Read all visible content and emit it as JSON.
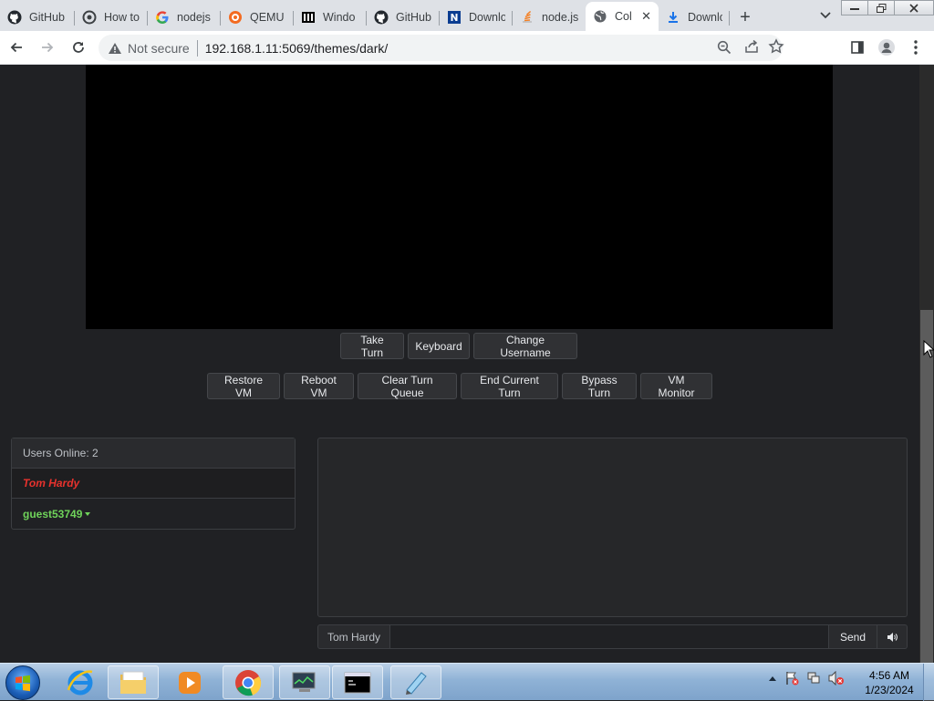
{
  "browser": {
    "tabs": [
      {
        "label": "GitHub",
        "icon": "github-icon"
      },
      {
        "label": "How to",
        "icon": "tool-icon"
      },
      {
        "label": "nodejs",
        "icon": "google-icon"
      },
      {
        "label": "QEMU",
        "icon": "qemu-icon"
      },
      {
        "label": "Windo",
        "icon": "archive-icon"
      },
      {
        "label": "GitHub",
        "icon": "github-icon"
      },
      {
        "label": "Downlo",
        "icon": "n-icon"
      },
      {
        "label": "node.js",
        "icon": "stack-icon"
      },
      {
        "label": "Col",
        "icon": "globe-icon",
        "active": true
      },
      {
        "label": "Downlo",
        "icon": "download-icon"
      }
    ],
    "new_tab": "+",
    "security_label": "Not secure",
    "url": "192.168.1.11:5069/themes/dark/"
  },
  "vm": {
    "turn_buttons": {
      "take_turn": "Take Turn",
      "keyboard": "Keyboard",
      "change_username": "Change Username"
    },
    "admin_buttons": {
      "restore_vm": "Restore VM",
      "reboot_vm": "Reboot VM",
      "clear_turn_queue": "Clear Turn Queue",
      "end_current_turn": "End Current Turn",
      "bypass_turn": "Bypass Turn",
      "vm_monitor": "VM Monitor"
    }
  },
  "users": {
    "header": "Users Online: 2",
    "list": [
      {
        "name": "Tom Hardy",
        "has_turn": true
      },
      {
        "name": "guest53749",
        "self": true
      }
    ]
  },
  "chat": {
    "username": "Tom Hardy",
    "message": "",
    "send_label": "Send"
  },
  "taskbar": {
    "time": "4:56 AM",
    "date": "1/23/2024"
  },
  "colors": {
    "page_bg": "#202124",
    "vm_bg": "#000000",
    "turn_user": "#e8322d",
    "self_user": "#6fd35a"
  }
}
